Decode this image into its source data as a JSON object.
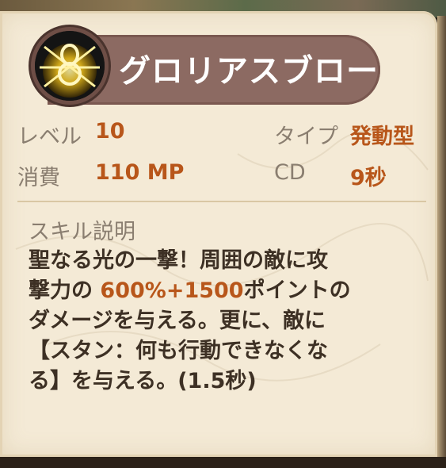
{
  "skill": {
    "name": "グロリアスブロー",
    "icon": "glorious-blow-icon"
  },
  "stats": {
    "level_label": "レベル",
    "level_value": "10",
    "type_label": "タイプ",
    "type_value": "発動型",
    "cost_label": "消費",
    "cost_value": "110 MP",
    "cd_label": "CD",
    "cd_value": "9秒"
  },
  "description": {
    "heading": "スキル説明",
    "line1": "聖なる光の一撃！周囲の敵に攻",
    "line2_pre": "撃力の ",
    "line2_highlight": "600%+1500",
    "line2_post": "ポイントの",
    "line3": "ダメージを与える。更に、敵に",
    "line4": "【スタン：何も行動できなくな",
    "line5": "る】を与える。(1.5秒)"
  },
  "colors": {
    "panel_bg": "#f4ead6",
    "banner": "#8c6a62",
    "value_orange": "#b8561a",
    "label_gray": "#8a7e70"
  }
}
